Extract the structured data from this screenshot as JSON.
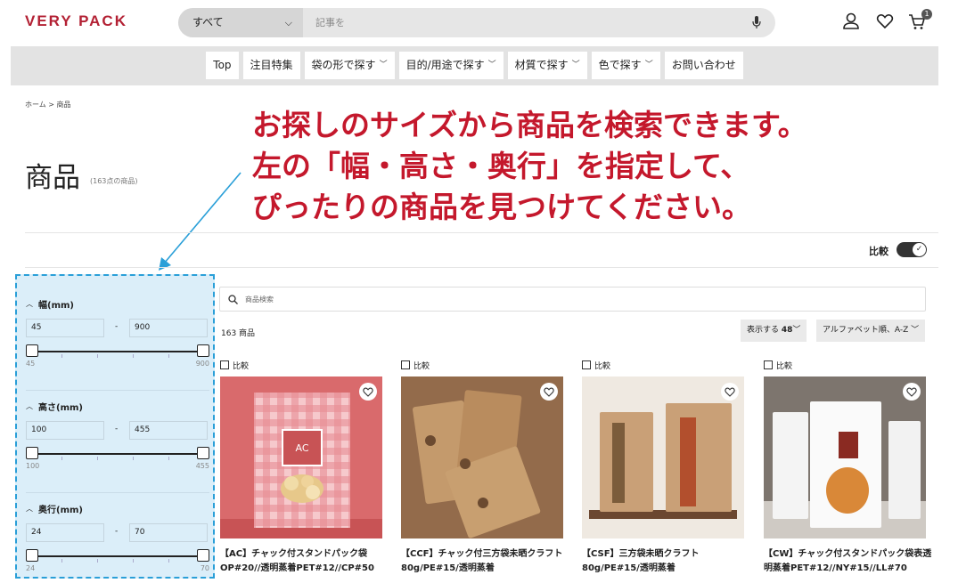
{
  "header": {
    "logo": "VERY PACK",
    "search_category": "すべて",
    "search_placeholder": "記事を",
    "cart_count": "1"
  },
  "nav": {
    "items": [
      {
        "label": "Top",
        "has_dropdown": false
      },
      {
        "label": "注目特集",
        "has_dropdown": false
      },
      {
        "label": "袋の形で探す",
        "has_dropdown": true
      },
      {
        "label": "目的/用途で探す",
        "has_dropdown": true
      },
      {
        "label": "材質で探す",
        "has_dropdown": true
      },
      {
        "label": "色で探す",
        "has_dropdown": true
      },
      {
        "label": "お問い合わせ",
        "has_dropdown": false
      }
    ]
  },
  "breadcrumb": "ホーム > 商品",
  "page": {
    "title": "商品",
    "count_label": "(163点の商品)"
  },
  "callout": {
    "line1": "お探しのサイズから商品を検索できます。",
    "line2": "左の「幅・高さ・奥行」を指定して、",
    "line3": "ぴったりの商品を見つけてください。"
  },
  "compare_toggle": {
    "label": "比較",
    "on": true
  },
  "filters": [
    {
      "title": "幅(mm)",
      "min_value": "45",
      "max_value": "900",
      "range_min": "45",
      "range_max": "900"
    },
    {
      "title": "高さ(mm)",
      "min_value": "100",
      "max_value": "455",
      "range_min": "100",
      "range_max": "455"
    },
    {
      "title": "奥行(mm)",
      "min_value": "24",
      "max_value": "70",
      "range_min": "24",
      "range_max": "70"
    }
  ],
  "product_search": {
    "placeholder": "商品検索"
  },
  "results": {
    "count": "163 商品",
    "per_page_label": "表示する",
    "per_page_value": "48",
    "sort_label": "アルファベット順、A-Z"
  },
  "products": [
    {
      "compare_label": "比較",
      "name": "【AC】チャック付スタンドパック袋OP#20//透明蒸着PET#12//CP#50"
    },
    {
      "compare_label": "比較",
      "name": "【CCF】チャック付三方袋未晒クラフト80g/PE#15/透明蒸着"
    },
    {
      "compare_label": "比較",
      "name": "【CSF】三方袋未晒クラフト80g/PE#15/透明蒸着"
    },
    {
      "compare_label": "比較",
      "name": "【CW】チャック付スタンドパック袋表透明蒸着PET#12//NY#15//LL#70"
    }
  ],
  "colors": {
    "brand": "#b32134",
    "callout": "#c4182c",
    "filter_bg": "#dbeef9",
    "filter_border": "#2a9fd8"
  }
}
